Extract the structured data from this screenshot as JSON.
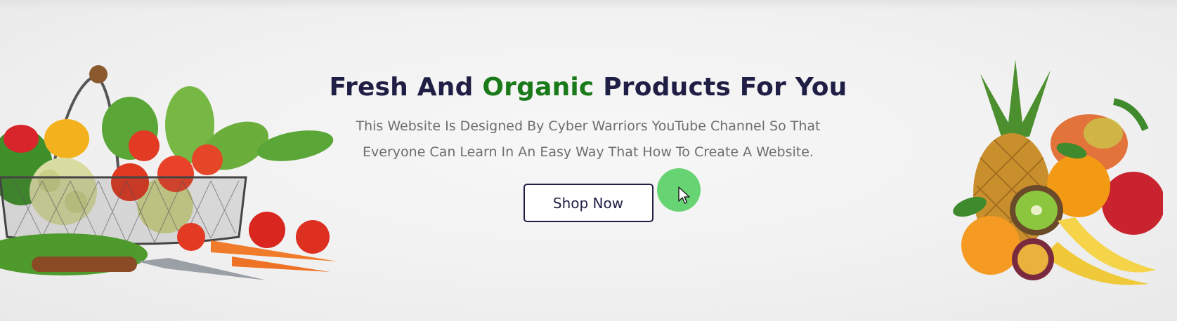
{
  "hero": {
    "title_part1": "Fresh And ",
    "title_accent": "Organic",
    "title_part2": " Products For You",
    "description_line1": "This Website Is Designed By Cyber Warriors YouTube Channel So That",
    "description_line2": "Everyone Can Learn In An Easy Way That How To Create A Website.",
    "cta_label": "Shop Now"
  },
  "images": {
    "left": "vegetable-basket-image",
    "right": "fruit-pile-image"
  },
  "icons": {
    "cursor": "mouse-pointer-icon"
  },
  "colors": {
    "title": "#1f1f45",
    "accent": "#1a7a1a",
    "text": "#6d6d6d",
    "cursor_highlight": "#5fd26b"
  }
}
